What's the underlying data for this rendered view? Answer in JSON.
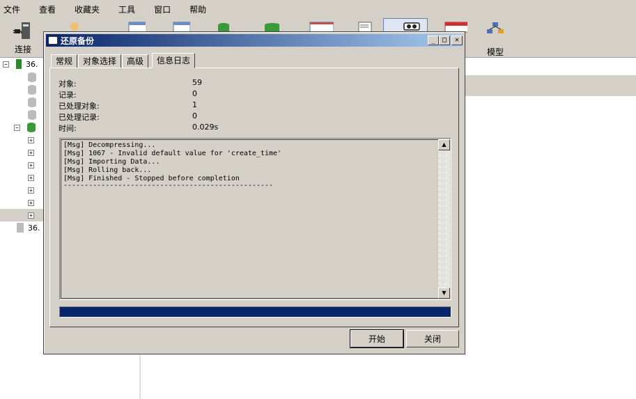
{
  "menu": [
    "文件",
    "查看",
    "收藏夹",
    "工具",
    "窗口",
    "帮助"
  ],
  "toolbar": {
    "connect_label": "连接",
    "model_label": "模型"
  },
  "tree": {
    "conn1": "36.",
    "conn2": "36."
  },
  "dialog": {
    "title": "还原备份",
    "min_glyph": "_",
    "max_glyph": "□",
    "close_glyph": "✕",
    "tabs": [
      "常规",
      "对象选择",
      "高级",
      "信息日志"
    ],
    "active_tab": 3,
    "info": [
      {
        "label": "对象:",
        "value": "59"
      },
      {
        "label": "记录:",
        "value": "0"
      },
      {
        "label": "已处理对象:",
        "value": "1"
      },
      {
        "label": "已处理记录:",
        "value": "0"
      },
      {
        "label": "时间:",
        "value": "0.029s"
      }
    ],
    "log": [
      "[Msg] Decompressing...",
      "[Msg] 1067 - Invalid default value for 'create_time'",
      "[Msg] Importing Data...",
      "[Msg] Rolling back...",
      "[Msg] Finished - Stopped before completion",
      "--------------------------------------------------"
    ],
    "progress": 1.0,
    "start_label": "开始",
    "close_label": "关闭"
  }
}
